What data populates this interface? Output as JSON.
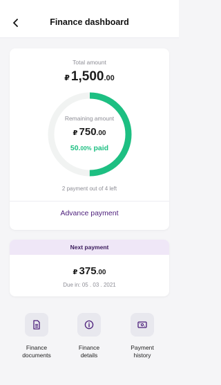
{
  "header": {
    "back_icon": "chevron-left-icon",
    "title": "Finance dashboard"
  },
  "summary": {
    "total_label": "Total amount",
    "currency": "₽",
    "total_whole": "1,500",
    "total_decimal": ".00",
    "remaining_label": "Remaining amount",
    "remaining_whole": "750",
    "remaining_decimal": ".00",
    "paid_percent_main": "50.",
    "paid_percent_small": "00%",
    "paid_suffix": " paid",
    "paid_fraction": 0.5,
    "payment_count": "2 payment out of 4 left",
    "advance_label": "Advance payment",
    "colors": {
      "progress": "#1dbf82",
      "track": "#f1f3f2",
      "link": "#4b1d7a"
    }
  },
  "next_payment": {
    "header": "Next payment",
    "amount_whole": "375",
    "amount_decimal": ".00",
    "due_text": "Due in: 05 . 03 . 2021",
    "header_bg": "#efe7f7"
  },
  "actions": [
    {
      "label": "Finance\ndocuments",
      "icon": "document-icon"
    },
    {
      "label": "Finance\ndetails",
      "icon": "info-icon"
    },
    {
      "label": "Payment\nhistory",
      "icon": "payment-card-icon"
    }
  ]
}
